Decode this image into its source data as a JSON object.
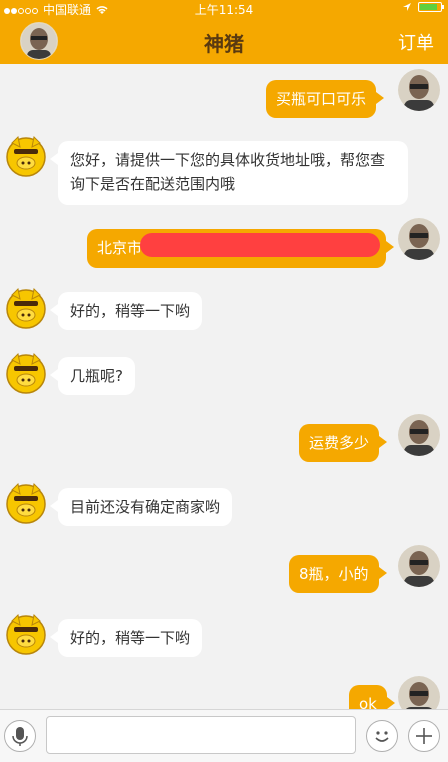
{
  "status_bar": {
    "carrier": "中国联通",
    "time": "上午11:54",
    "signal_icon": "signal-dots-icon",
    "wifi_icon": "wifi-icon",
    "location_icon": "location-arrow-icon",
    "battery_icon": "battery-icon",
    "battery_level": 0.85
  },
  "header": {
    "title": "神猪",
    "right_action": "订单",
    "avatar_icon": "user-avatar-icon"
  },
  "colors": {
    "accent": "#f5a800",
    "background": "#f2f2f2",
    "bubble_left": "#ffffff",
    "redaction": "#ff4040"
  },
  "messages": [
    {
      "side": "right",
      "text": "买瓶可口可乐"
    },
    {
      "side": "left",
      "text": "您好，请提供一下您的具体收货地址哦，帮您查询下是否在配送范围内哦"
    },
    {
      "side": "right",
      "text": "北京市",
      "redacted": true
    },
    {
      "side": "left",
      "text": "好的，稍等一下哟"
    },
    {
      "side": "left",
      "text": "几瓶呢?"
    },
    {
      "side": "right",
      "text": "运费多少"
    },
    {
      "side": "left",
      "text": "目前还没有确定商家哟"
    },
    {
      "side": "right",
      "text": "8瓶，小的"
    },
    {
      "side": "left",
      "text": "好的，稍等一下哟"
    },
    {
      "side": "right",
      "text": "ok"
    }
  ],
  "input_bar": {
    "mic_icon": "microphone-icon",
    "emoji_icon": "emoji-smile-icon",
    "plus_icon": "plus-icon",
    "text_value": ""
  }
}
